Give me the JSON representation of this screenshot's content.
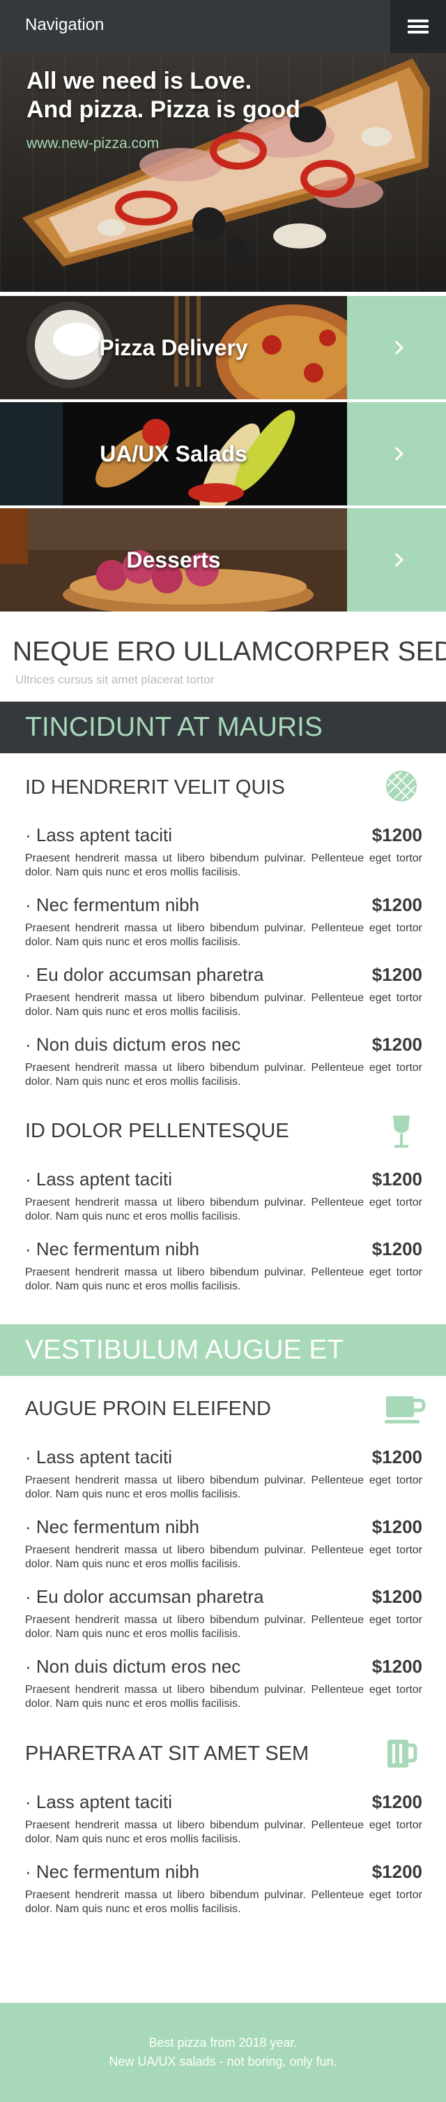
{
  "nav": {
    "title": "Navigation",
    "menu_icon": "hamburger-menu-icon"
  },
  "hero": {
    "title": "All we need is Love.\nAnd pizza. Pizza is good",
    "link": "www.new-pizza.com"
  },
  "categories": [
    {
      "label": "Pizza Delivery",
      "arrow_icon": "chevron-right-icon"
    },
    {
      "label": "UA/UX Salads",
      "arrow_icon": "chevron-right-icon"
    },
    {
      "label": "Desserts",
      "arrow_icon": "chevron-right-icon"
    }
  ],
  "headline": {
    "title": "NEQUE ERO ULLAMCORPER SED",
    "subtitle": "Ultrices cursus sit amet placerat tortor"
  },
  "sections": [
    {
      "title": "TINCIDUNT AT MAURIS",
      "groups": [
        {
          "title": "ID HENDRERIT VELIT QUIS",
          "icon": "pizza-icon",
          "items": [
            {
              "name": "· Lass aptent taciti",
              "price": "$1200",
              "desc": "Praesent hendrerit massa ut libero bibendum pulvinar. Pellenteue eget tortor dolor. Nam quis nunc et eros mollis facilisis."
            },
            {
              "name": "· Nec fermentum nibh",
              "price": "$1200",
              "desc": "Praesent hendrerit massa ut libero bibendum pulvinar. Pellenteue eget tortor dolor. Nam quis nunc et eros mollis facilisis."
            },
            {
              "name": "· Eu dolor accumsan pharetra",
              "price": "$1200",
              "desc": "Praesent hendrerit massa ut libero bibendum pulvinar. Pellenteue eget tortor dolor. Nam quis nunc et eros mollis facilisis."
            },
            {
              "name": "· Non duis dictum eros nec",
              "price": "$1200",
              "desc": "Praesent hendrerit massa ut libero bibendum pulvinar. Pellenteue eget tortor dolor. Nam quis nunc et eros mollis facilisis."
            }
          ]
        },
        {
          "title": "ID DOLOR PELLENTESQUE",
          "icon": "wine-glass-icon",
          "items": [
            {
              "name": "· Lass aptent taciti",
              "price": "$1200",
              "desc": "Praesent hendrerit massa ut libero bibendum pulvinar. Pellenteue eget tortor dolor. Nam quis nunc et eros mollis facilisis."
            },
            {
              "name": "· Nec fermentum nibh",
              "price": "$1200",
              "desc": "Praesent hendrerit massa ut libero bibendum pulvinar. Pellenteue eget tortor dolor. Nam quis nunc et eros mollis facilisis."
            }
          ]
        }
      ]
    },
    {
      "title": "VESTIBULUM AUGUE ET",
      "groups": [
        {
          "title": "AUGUE PROIN ELEIFEND",
          "icon": "coffee-cup-icon",
          "items": [
            {
              "name": "· Lass aptent taciti",
              "price": "$1200",
              "desc": "Praesent hendrerit massa ut libero bibendum pulvinar. Pellenteue eget tortor dolor. Nam quis nunc et eros mollis facilisis."
            },
            {
              "name": "· Nec fermentum nibh",
              "price": "$1200",
              "desc": "Praesent hendrerit massa ut libero bibendum pulvinar. Pellenteue eget tortor dolor. Nam quis nunc et eros mollis facilisis."
            },
            {
              "name": "· Eu dolor accumsan pharetra",
              "price": "$1200",
              "desc": "Praesent hendrerit massa ut libero bibendum pulvinar. Pellenteue eget tortor dolor. Nam quis nunc et eros mollis facilisis."
            },
            {
              "name": "· Non duis dictum eros nec",
              "price": "$1200",
              "desc": "Praesent hendrerit massa ut libero bibendum pulvinar. Pellenteue eget tortor dolor. Nam quis nunc et eros mollis facilisis."
            }
          ]
        },
        {
          "title": "PHARETRA AT SIT AMET SEM",
          "icon": "beer-mug-icon",
          "items": [
            {
              "name": "· Lass aptent taciti",
              "price": "$1200",
              "desc": "Praesent hendrerit massa ut libero bibendum pulvinar. Pellenteue eget tortor dolor. Nam quis nunc et eros mollis facilisis."
            },
            {
              "name": "· Nec fermentum nibh",
              "price": "$1200",
              "desc": "Praesent hendrerit massa ut libero bibendum pulvinar. Pellenteue eget tortor dolor. Nam quis nunc et eros mollis facilisis."
            }
          ]
        }
      ]
    }
  ],
  "footer": {
    "line1": "Best pizza from 2018 year.",
    "line2": "New UA/UX salads - not boring, only fun."
  },
  "colors": {
    "accent": "#a7d8b7",
    "dark": "#34393e",
    "darker": "#23272b",
    "text": "#3a3a3a"
  }
}
